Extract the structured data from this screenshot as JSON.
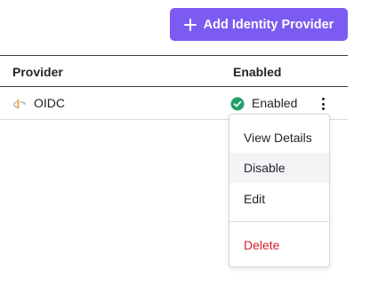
{
  "toolbar": {
    "add_button_label": "Add Identity Provider",
    "add_button_color": "#7b5bf1"
  },
  "table": {
    "columns": [
      "Provider",
      "Enabled"
    ],
    "rows": [
      {
        "provider": "OIDC",
        "provider_icon": "oidc-logo-icon",
        "status": "Enabled",
        "status_icon": "check-circle-icon",
        "status_color": "#22a06b"
      }
    ]
  },
  "row_menu": {
    "items": [
      {
        "label": "View Details",
        "state": "normal"
      },
      {
        "label": "Disable",
        "state": "hover"
      },
      {
        "label": "Edit",
        "state": "normal"
      },
      {
        "label": "Delete",
        "state": "danger",
        "color": "#d0222d"
      }
    ]
  }
}
